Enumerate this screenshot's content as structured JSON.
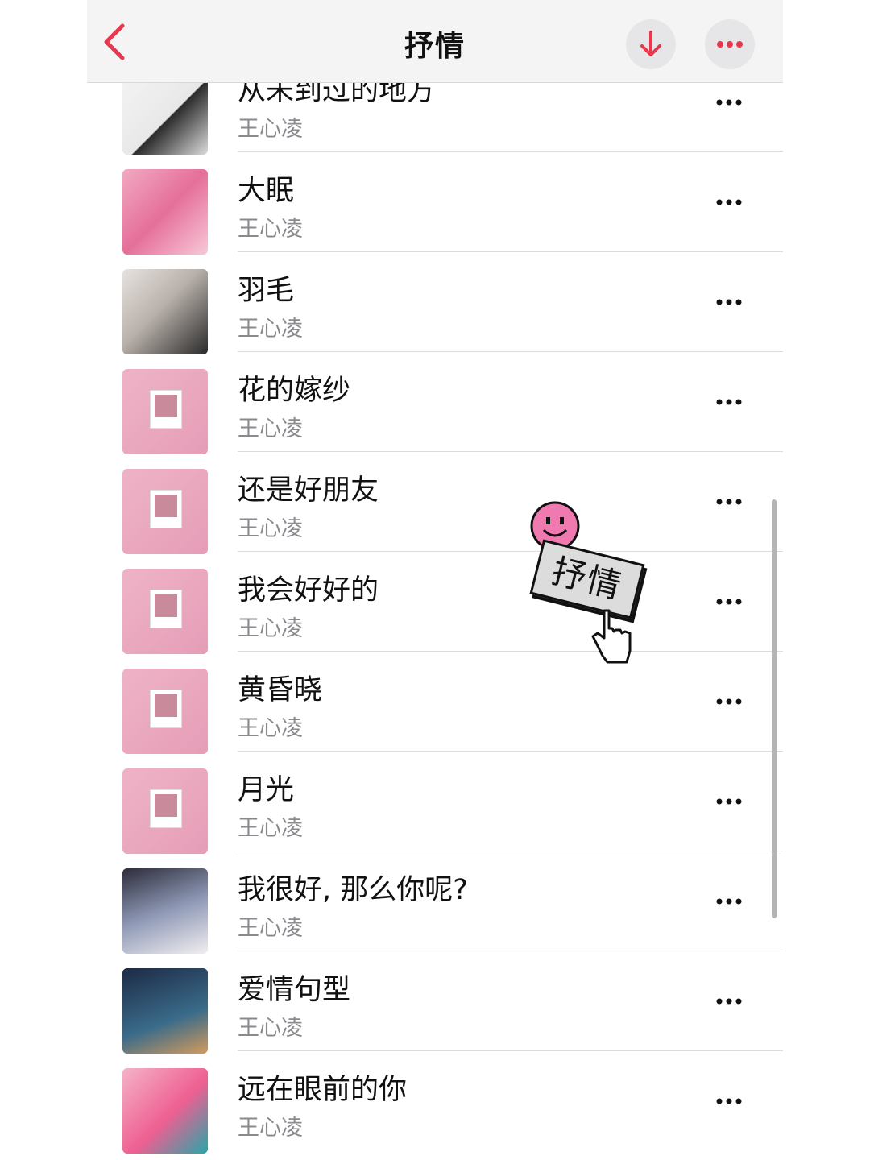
{
  "header": {
    "title": "抒情",
    "accent_color": "#e8384f",
    "back_icon": "chevron-left-icon",
    "download_icon": "arrow-down-icon",
    "more_icon": "ellipsis-icon"
  },
  "songs": [
    {
      "title": "从未到过的地方",
      "artist": "王心凌"
    },
    {
      "title": "大眠",
      "artist": "王心凌"
    },
    {
      "title": "羽毛",
      "artist": "王心凌"
    },
    {
      "title": "花的嫁纱",
      "artist": "王心凌"
    },
    {
      "title": "还是好朋友",
      "artist": "王心凌"
    },
    {
      "title": "我会好好的",
      "artist": "王心凌"
    },
    {
      "title": "黄昏晓",
      "artist": "王心凌"
    },
    {
      "title": "月光",
      "artist": "王心凌"
    },
    {
      "title": "我很好, 那么你呢?",
      "artist": "王心凌"
    },
    {
      "title": "爱情句型",
      "artist": "王心凌"
    },
    {
      "title": "远在眼前的你",
      "artist": "王心凌"
    }
  ],
  "sticker": {
    "label": "抒情",
    "icons": [
      "smiley-icon",
      "pointer-hand-icon"
    ]
  }
}
